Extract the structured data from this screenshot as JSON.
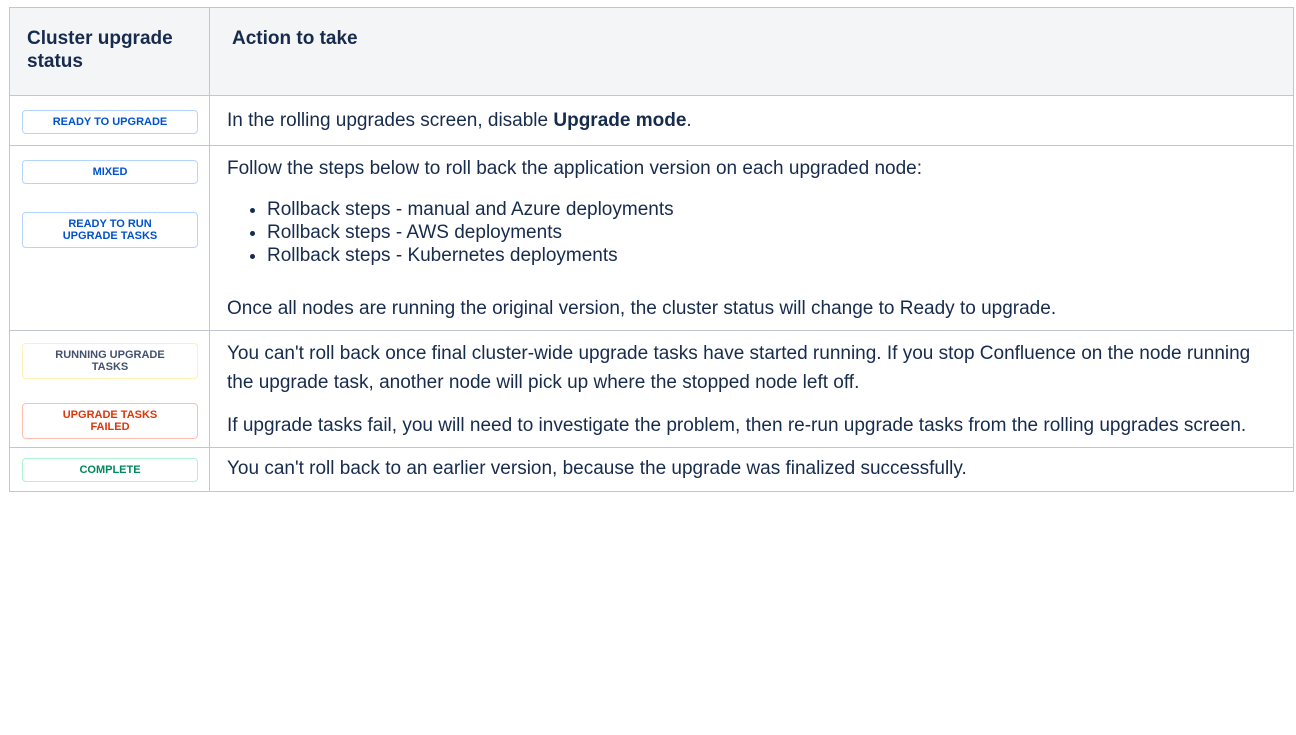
{
  "header": {
    "status_col": "Cluster upgrade status",
    "action_col": "Action to take"
  },
  "rows": [
    {
      "lozenges": [
        {
          "label": "READY TO UPGRADE",
          "tone": "blue"
        }
      ],
      "action_pre": "In the rolling upgrades screen, disable ",
      "action_bold": "Upgrade mode",
      "action_post": "."
    },
    {
      "lozenges": [
        {
          "label": "MIXED",
          "tone": "blue"
        },
        {
          "label": "READY TO RUN UPGRADE TASKS",
          "tone": "blue"
        }
      ],
      "intro": "Follow the steps below to roll back the application version on each upgraded node:",
      "list": [
        "Rollback steps - manual and Azure deployments",
        "Rollback steps - AWS deployments",
        "Rollback steps - Kubernetes deployments"
      ],
      "outro": "Once all nodes are running the original version, the cluster status will change to Ready to upgrade."
    },
    {
      "lozenges": [
        {
          "label": "RUNNING UPGRADE TASKS",
          "tone": "neutral"
        },
        {
          "label": "UPGRADE TASKS FAILED",
          "tone": "red"
        }
      ],
      "para1": "You can't roll back once final cluster-wide upgrade tasks have started running. If you stop Confluence on the node running the upgrade task, another node will pick up where the stopped node left off.",
      "para2": "If upgrade tasks fail, you will need to investigate the problem, then re-run upgrade tasks from the rolling upgrades screen."
    },
    {
      "lozenges": [
        {
          "label": "COMPLETE",
          "tone": "green"
        }
      ],
      "action": "You can't roll back to an earlier version, because the upgrade was finalized successfully."
    }
  ],
  "colors": {
    "border": "#c1c7d0",
    "header_bg": "#f4f5f7",
    "blue": "#0052cc",
    "neutral": "#42526e",
    "red": "#de350b",
    "green": "#00875a"
  }
}
